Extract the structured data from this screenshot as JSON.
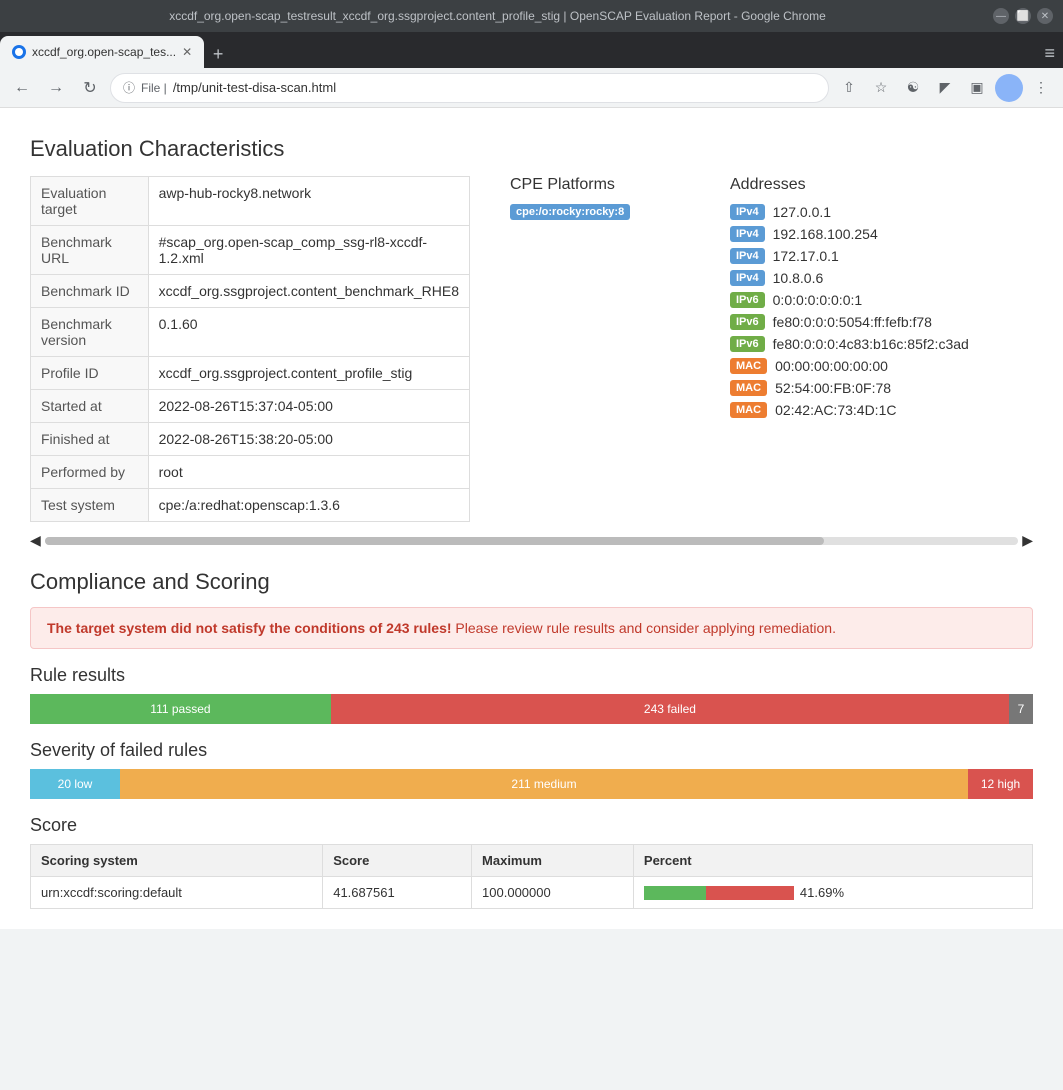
{
  "browser": {
    "title": "xccdf_org.open-scap_testresult_xccdf_org.ssgproject.content_profile_stig | OpenSCAP Evaluation Report - Google Chrome",
    "tab_label": "xccdf_org.open-scap_tes...",
    "address": "/tmp/unit-test-disa-scan.html",
    "address_prefix": "File  |"
  },
  "page": {
    "section_title": "Evaluation Characteristics",
    "compliance_title": "Compliance and Scoring",
    "rule_results_title": "Rule results",
    "severity_title": "Severity of failed rules",
    "score_title": "Score"
  },
  "eval_table": {
    "rows": [
      {
        "label": "Evaluation target",
        "value": "awp-hub-rocky8.network"
      },
      {
        "label": "Benchmark URL",
        "value": "#scap_org.open-scap_comp_ssg-rl8-xccdf-1.2.xml"
      },
      {
        "label": "Benchmark ID",
        "value": "xccdf_org.ssgproject.content_benchmark_RHE8"
      },
      {
        "label": "Benchmark version",
        "value": "0.1.60"
      },
      {
        "label": "Profile ID",
        "value": "xccdf_org.ssgproject.content_profile_stig"
      },
      {
        "label": "Started at",
        "value": "2022-08-26T15:37:04-05:00"
      },
      {
        "label": "Finished at",
        "value": "2022-08-26T15:38:20-05:00"
      },
      {
        "label": "Performed by",
        "value": "root"
      },
      {
        "label": "Test system",
        "value": "cpe:/a:redhat:openscap:1.3.6"
      }
    ]
  },
  "cpe": {
    "title": "CPE Platforms",
    "items": [
      {
        "badge": "cpe:/o:rocky:rocky:8",
        "type": "cpe"
      }
    ]
  },
  "addresses": {
    "title": "Addresses",
    "items": [
      {
        "badge": "IPv4",
        "type": "ipv4",
        "value": "127.0.0.1"
      },
      {
        "badge": "IPv4",
        "type": "ipv4",
        "value": "192.168.100.254"
      },
      {
        "badge": "IPv4",
        "type": "ipv4",
        "value": "172.17.0.1"
      },
      {
        "badge": "IPv4",
        "type": "ipv4",
        "value": "10.8.0.6"
      },
      {
        "badge": "IPv6",
        "type": "ipv6",
        "value": "0:0:0:0:0:0:0:1"
      },
      {
        "badge": "IPv6",
        "type": "ipv6",
        "value": "fe80:0:0:0:5054:ff:fefb:f78"
      },
      {
        "badge": "IPv6",
        "type": "ipv6",
        "value": "fe80:0:0:0:4c83:b16c:85f2:c3ad"
      },
      {
        "badge": "MAC",
        "type": "mac",
        "value": "00:00:00:00:00:00"
      },
      {
        "badge": "MAC",
        "type": "mac",
        "value": "52:54:00:FB:0F:78"
      },
      {
        "badge": "MAC",
        "type": "mac",
        "value": "02:42:AC:73:4D:1C"
      }
    ]
  },
  "compliance": {
    "alert_text_strong": "The target system did not satisfy the conditions of 243 rules!",
    "alert_text_rest": " Please review rule results and consider applying remediation."
  },
  "rule_results": {
    "passed_count": "111 passed",
    "failed_count": "243 failed",
    "error_count": "7",
    "pass_width_pct": 30,
    "fail_width_pct": 66
  },
  "severity": {
    "low_label": "20 low",
    "medium_label": "211 medium",
    "high_label": "12 high"
  },
  "score_table": {
    "headers": [
      "Scoring system",
      "Score",
      "Maximum",
      "Percent"
    ],
    "rows": [
      {
        "system": "urn:xccdf:scoring:default",
        "score": "41.687561",
        "maximum": "100.000000",
        "percent": "41.69%",
        "percent_val": 41.69
      }
    ]
  }
}
